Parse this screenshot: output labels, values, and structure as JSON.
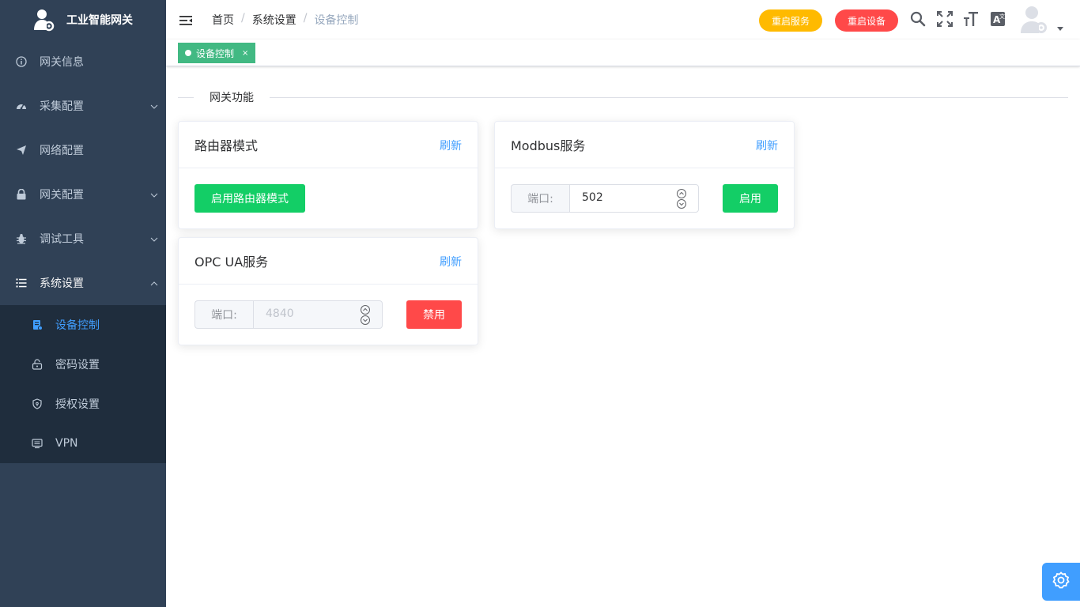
{
  "app": {
    "title": "工业智能网关"
  },
  "sidebar": {
    "items": [
      {
        "label": "网关信息",
        "icon": "info-icon"
      },
      {
        "label": "采集配置",
        "icon": "dashboard-icon",
        "expandable": true
      },
      {
        "label": "网络配置",
        "icon": "send-icon"
      },
      {
        "label": "网关配置",
        "icon": "lock-icon",
        "expandable": true
      },
      {
        "label": "调试工具",
        "icon": "bug-icon",
        "expandable": true
      },
      {
        "label": "系统设置",
        "icon": "list-icon",
        "expandable": true,
        "expanded": true
      }
    ],
    "subitems": [
      {
        "label": "设备控制",
        "icon": "device-icon",
        "active": true
      },
      {
        "label": "密码设置",
        "icon": "unlock-icon"
      },
      {
        "label": "授权设置",
        "icon": "shield-icon"
      },
      {
        "label": "VPN",
        "icon": "monitor-icon"
      }
    ]
  },
  "header": {
    "breadcrumb": [
      "首页",
      "系统设置",
      "设备控制"
    ],
    "separator": "/",
    "restart_service_label": "重启服务",
    "restart_device_label": "重启设备"
  },
  "tags": {
    "active_tag": "设备控制",
    "close_symbol": "×"
  },
  "main": {
    "section_title": "网关功能",
    "router_card": {
      "title": "路由器模式",
      "refresh_label": "刷新",
      "button_label": "启用路由器模式"
    },
    "modbus_card": {
      "title": "Modbus服务",
      "refresh_label": "刷新",
      "port_label": "端口:",
      "port_value": "502",
      "button_label": "启用"
    },
    "opcua_card": {
      "title": "OPC UA服务",
      "refresh_label": "刷新",
      "port_label": "端口:",
      "port_value": "4840",
      "button_label": "禁用"
    }
  },
  "colors": {
    "sidebar_bg": "#304156",
    "submenu_bg": "#1f2d3d",
    "active_text": "#409eff",
    "success": "#13ce66",
    "danger": "#ff4949",
    "warning": "#ffba00",
    "tag_green": "#42b983"
  }
}
